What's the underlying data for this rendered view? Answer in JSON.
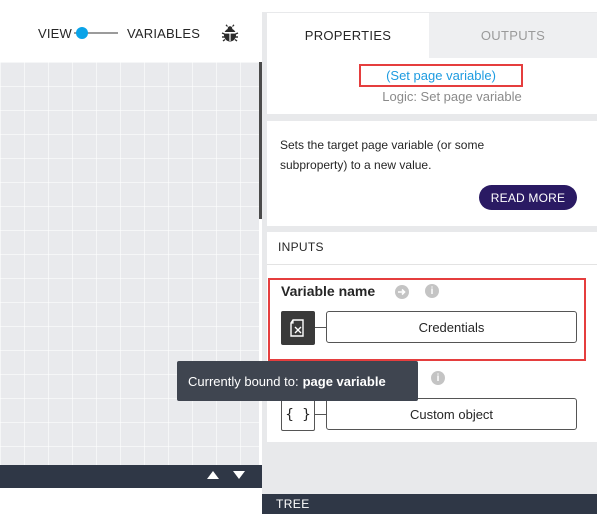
{
  "toolbar": {
    "view_label": "VIEW",
    "variables_label": "VARIABLES",
    "toggle_state": "view",
    "debug_icon": "bug-icon"
  },
  "canvas": {
    "nav_up_icon": "triangle-up-icon",
    "nav_down_icon": "triangle-down-icon"
  },
  "tabs": [
    {
      "label": "PROPERTIES",
      "active": true
    },
    {
      "label": "OUTPUTS",
      "active": false
    }
  ],
  "node": {
    "name": "(Set page variable)",
    "type_label": "Logic: Set page variable"
  },
  "description": {
    "text": "Sets the target page variable (or some subproperty) to a new value.",
    "read_more_label": "READ MORE"
  },
  "inputs": {
    "heading": "INPUTS",
    "variable_name": {
      "label": "Variable name",
      "value": "Credentials",
      "type_icon": "page-variable-icon"
    },
    "value_input": {
      "value": "Custom object",
      "type_icon": "curly-braces-icon",
      "type_glyph": "{ }"
    },
    "info_glyph": "i"
  },
  "tooltip": {
    "prefix": "Currently bound to:",
    "value": "page variable"
  },
  "bottom_panel": {
    "label": "TREE"
  },
  "colors": {
    "accent_blue": "#1d9be0",
    "toggle_blue": "#0aa3e8",
    "highlight_red": "#e53e3e",
    "button_navy": "#2a1a63",
    "dark_bar": "#2f3746",
    "panel_bg": "#e8e9eb"
  }
}
